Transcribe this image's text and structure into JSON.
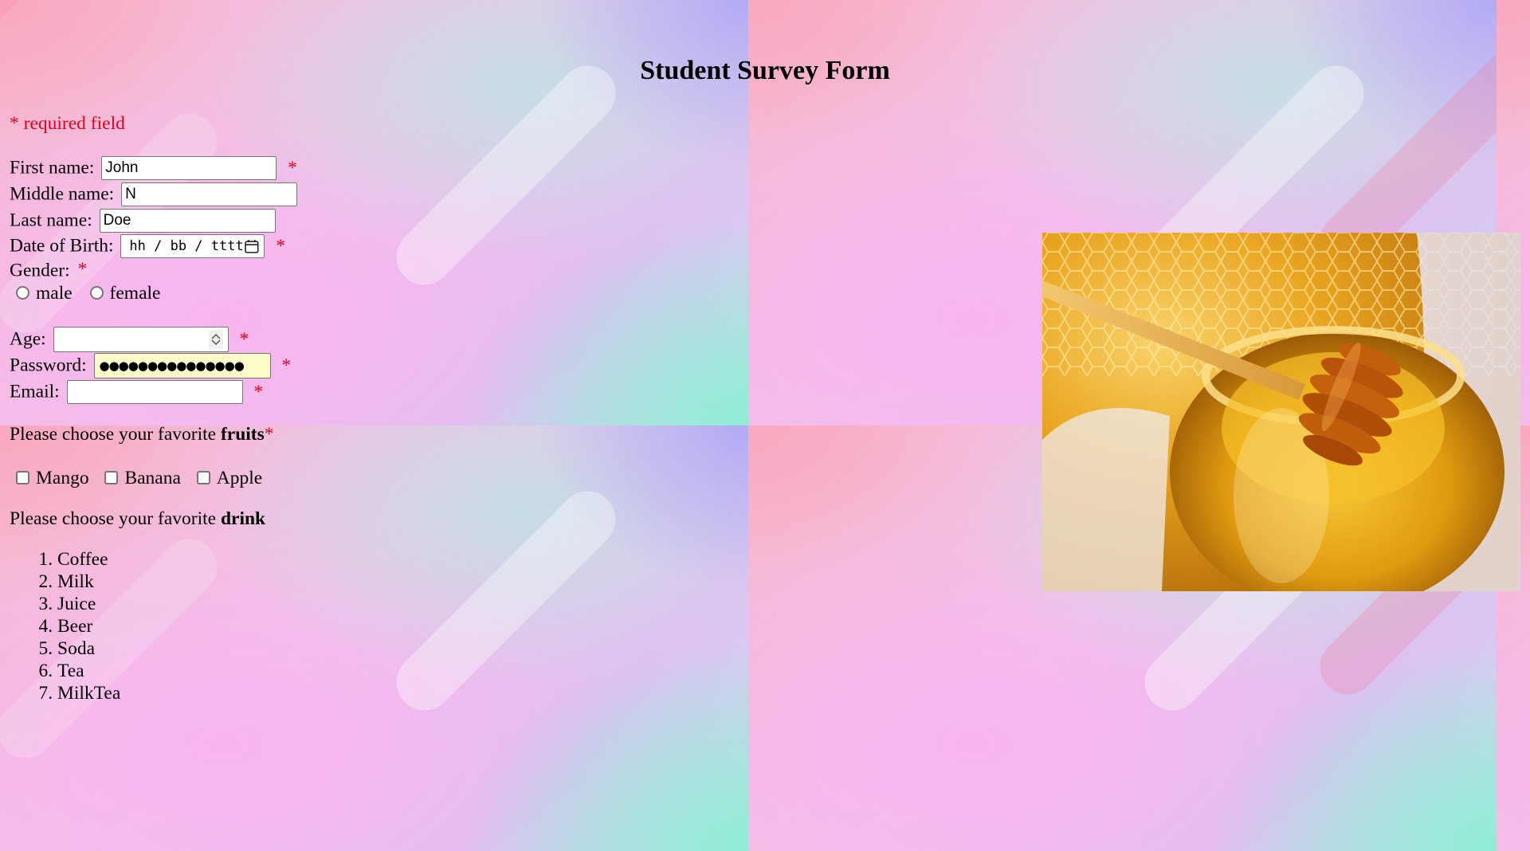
{
  "page": {
    "title": "Student Survey Form",
    "required_note": "* required field"
  },
  "form": {
    "first_name": {
      "label": "First name:",
      "value": "John",
      "required_mark": "*"
    },
    "middle_name": {
      "label": "Middle name:",
      "value": "N"
    },
    "last_name": {
      "label": "Last name:",
      "value": "Doe"
    },
    "dob": {
      "label": "Date of Birth:",
      "placeholder": "hh / bb / tttt",
      "required_mark": "*"
    },
    "gender": {
      "label": "Gender:",
      "required_mark": "*",
      "options": [
        "male",
        "female"
      ]
    },
    "age": {
      "label": "Age:",
      "value": "",
      "required_mark": "*"
    },
    "password": {
      "label": "Password:",
      "masked_value": "●●●●●●●●●●●●●●●",
      "required_mark": "*"
    },
    "email": {
      "label": "Email:",
      "value": "",
      "required_mark": "*"
    }
  },
  "fruits": {
    "prompt_prefix": "Please choose your favorite ",
    "prompt_bold": "fruits",
    "required_mark": "*",
    "options": [
      "Mango",
      "Banana",
      "Apple"
    ]
  },
  "drinks": {
    "prompt_prefix": "Please choose your favorite ",
    "prompt_bold": "drink",
    "items": [
      "Coffee",
      "Milk",
      "Juice",
      "Beer",
      "Soda",
      "Tea",
      "MilkTea"
    ]
  },
  "colors": {
    "required": "#e3001b",
    "password_autofill_bg": "#fdfbc8"
  },
  "icons": {
    "calendar": "calendar-icon",
    "spinner": "number-spinner-icon"
  },
  "image": {
    "subject": "honey-jar-with-dipper"
  }
}
